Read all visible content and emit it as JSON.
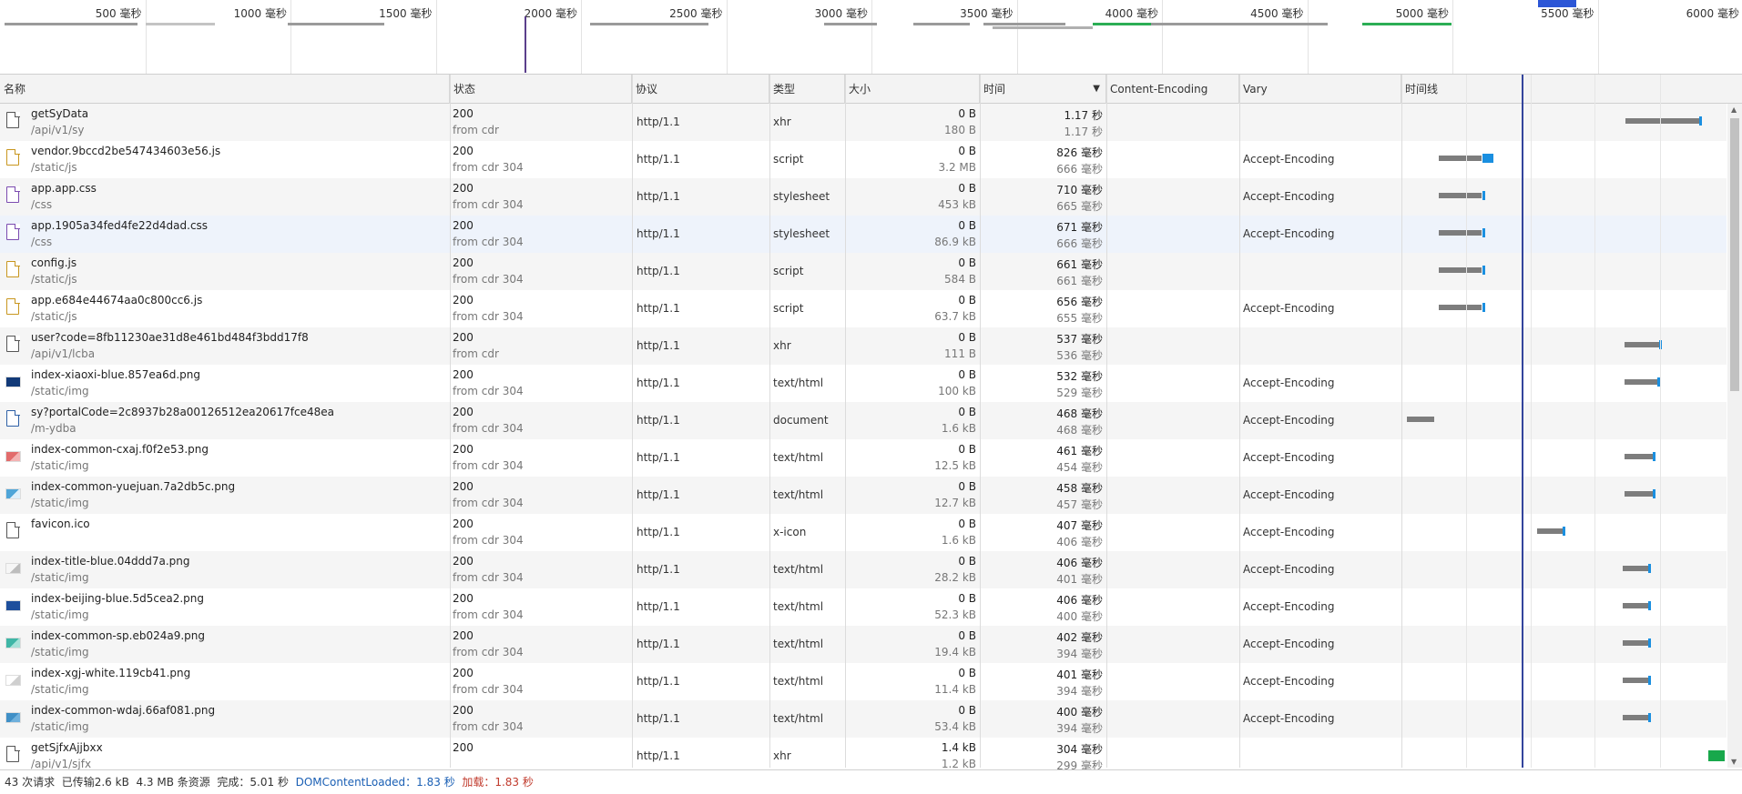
{
  "overview": {
    "ticks": [
      "500 毫秒",
      "1000 毫秒",
      "1500 毫秒",
      "2000 毫秒",
      "2500 毫秒",
      "3000 毫秒",
      "3500 毫秒",
      "4000 毫秒",
      "4500 毫秒",
      "5000 毫秒",
      "5500 毫秒",
      "6000 毫秒"
    ]
  },
  "columns": {
    "name": "名称",
    "status": "状态",
    "protocol": "协议",
    "type": "类型",
    "size": "大小",
    "time": "时间",
    "encoding": "Content-Encoding",
    "vary": "Vary",
    "timeline": "时间线"
  },
  "rows": [
    {
      "name": "getSyData",
      "path": "/api/v1/sy",
      "icon": "file",
      "status": "200",
      "source": "from cdr",
      "protocol": "http/1.1",
      "type": "xhr",
      "size1": "0 B",
      "size2": "180 B",
      "time1": "1.17 秒",
      "time2": "1.17 秒",
      "vary": ""
    },
    {
      "name": "vendor.9bccd2be547434603e56.js",
      "path": "/static/js",
      "icon": "js",
      "status": "200",
      "source": "from cdr 304",
      "protocol": "http/1.1",
      "type": "script",
      "size1": "0 B",
      "size2": "3.2 MB",
      "time1": "826 毫秒",
      "time2": "666 毫秒",
      "vary": "Accept-Encoding"
    },
    {
      "name": "app.app.css",
      "path": "/css",
      "icon": "css",
      "status": "200",
      "source": "from cdr 304",
      "protocol": "http/1.1",
      "type": "stylesheet",
      "size1": "0 B",
      "size2": "453 kB",
      "time1": "710 毫秒",
      "time2": "665 毫秒",
      "vary": "Accept-Encoding"
    },
    {
      "name": "app.1905a34fed4fe22d4dad.css",
      "path": "/css",
      "icon": "css",
      "status": "200",
      "source": "from cdr 304",
      "protocol": "http/1.1",
      "type": "stylesheet",
      "size1": "0 B",
      "size2": "86.9 kB",
      "time1": "671 毫秒",
      "time2": "666 毫秒",
      "vary": "Accept-Encoding"
    },
    {
      "name": "config.js",
      "path": "/static/js",
      "icon": "js",
      "status": "200",
      "source": "from cdr 304",
      "protocol": "http/1.1",
      "type": "script",
      "size1": "0 B",
      "size2": "584 B",
      "time1": "661 毫秒",
      "time2": "661 毫秒",
      "vary": ""
    },
    {
      "name": "app.e684e44674aa0c800cc6.js",
      "path": "/static/js",
      "icon": "js",
      "status": "200",
      "source": "from cdr 304",
      "protocol": "http/1.1",
      "type": "script",
      "size1": "0 B",
      "size2": "63.7 kB",
      "time1": "656 毫秒",
      "time2": "655 毫秒",
      "vary": "Accept-Encoding"
    },
    {
      "name": "user?code=8fb11230ae31d8e461bd484f3bdd17f8",
      "path": "/api/v1/lcba",
      "icon": "file",
      "status": "200",
      "source": "from cdr",
      "protocol": "http/1.1",
      "type": "xhr",
      "size1": "0 B",
      "size2": "111 B",
      "time1": "537 毫秒",
      "time2": "536 毫秒",
      "vary": ""
    },
    {
      "name": "index-xiaoxi-blue.857ea6d.png",
      "path": "/static/img",
      "icon": "img-navy",
      "status": "200",
      "source": "from cdr 304",
      "protocol": "http/1.1",
      "type": "text/html",
      "size1": "0 B",
      "size2": "100 kB",
      "time1": "532 毫秒",
      "time2": "529 毫秒",
      "vary": "Accept-Encoding"
    },
    {
      "name": "sy?portalCode=2c8937b28a00126512ea20617fce48ea",
      "path": "/m-ydba",
      "icon": "doc",
      "status": "200",
      "source": "from cdr 304",
      "protocol": "http/1.1",
      "type": "document",
      "size1": "0 B",
      "size2": "1.6 kB",
      "time1": "468 毫秒",
      "time2": "468 毫秒",
      "vary": "Accept-Encoding"
    },
    {
      "name": "index-common-cxaj.f0f2e53.png",
      "path": "/static/img",
      "icon": "img-red",
      "status": "200",
      "source": "from cdr 304",
      "protocol": "http/1.1",
      "type": "text/html",
      "size1": "0 B",
      "size2": "12.5 kB",
      "time1": "461 毫秒",
      "time2": "454 毫秒",
      "vary": "Accept-Encoding"
    },
    {
      "name": "index-common-yuejuan.7a2db5c.png",
      "path": "/static/img",
      "icon": "img-cyan",
      "status": "200",
      "source": "from cdr 304",
      "protocol": "http/1.1",
      "type": "text/html",
      "size1": "0 B",
      "size2": "12.7 kB",
      "time1": "458 毫秒",
      "time2": "457 毫秒",
      "vary": "Accept-Encoding"
    },
    {
      "name": "favicon.ico",
      "path": "",
      "icon": "file",
      "status": "200",
      "source": "from cdr 304",
      "protocol": "http/1.1",
      "type": "x-icon",
      "size1": "0 B",
      "size2": "1.6 kB",
      "time1": "407 毫秒",
      "time2": "406 毫秒",
      "vary": "Accept-Encoding"
    },
    {
      "name": "index-title-blue.04ddd7a.png",
      "path": "/static/img",
      "icon": "img-line",
      "status": "200",
      "source": "from cdr 304",
      "protocol": "http/1.1",
      "type": "text/html",
      "size1": "0 B",
      "size2": "28.2 kB",
      "time1": "406 毫秒",
      "time2": "401 毫秒",
      "vary": "Accept-Encoding"
    },
    {
      "name": "index-beijing-blue.5d5cea2.png",
      "path": "/static/img",
      "icon": "img-blue",
      "status": "200",
      "source": "from cdr 304",
      "protocol": "http/1.1",
      "type": "text/html",
      "size1": "0 B",
      "size2": "52.3 kB",
      "time1": "406 毫秒",
      "time2": "400 毫秒",
      "vary": "Accept-Encoding"
    },
    {
      "name": "index-common-sp.eb024a9.png",
      "path": "/static/img",
      "icon": "img-teal",
      "status": "200",
      "source": "from cdr 304",
      "protocol": "http/1.1",
      "type": "text/html",
      "size1": "0 B",
      "size2": "19.4 kB",
      "time1": "402 毫秒",
      "time2": "394 毫秒",
      "vary": "Accept-Encoding"
    },
    {
      "name": "index-xgj-white.119cb41.png",
      "path": "/static/img",
      "icon": "img-white",
      "status": "200",
      "source": "from cdr 304",
      "protocol": "http/1.1",
      "type": "text/html",
      "size1": "0 B",
      "size2": "11.4 kB",
      "time1": "401 毫秒",
      "time2": "394 毫秒",
      "vary": "Accept-Encoding"
    },
    {
      "name": "index-common-wdaj.66af081.png",
      "path": "/static/img",
      "icon": "img-sky",
      "status": "200",
      "source": "from cdr 304",
      "protocol": "http/1.1",
      "type": "text/html",
      "size1": "0 B",
      "size2": "53.4 kB",
      "time1": "400 毫秒",
      "time2": "394 毫秒",
      "vary": "Accept-Encoding"
    },
    {
      "name": "getSjfxAjjbxx",
      "path": "/api/v1/sjfx",
      "icon": "file",
      "status": "200",
      "source": "",
      "protocol": "http/1.1",
      "type": "xhr",
      "size1": "1.4 kB",
      "size2": "1.2 kB",
      "time1": "304 毫秒",
      "time2": "299 毫秒",
      "vary": ""
    }
  ],
  "status_bar": {
    "requests": "43 次请求",
    "transferred": "已传输2.6 kB",
    "resources": "4.3 MB 条资源",
    "finish": "完成：5.01 秒",
    "dcl": "DOMContentLoaded：1.83 秒",
    "load": "加载：1.83 秒"
  },
  "colors": {
    "dcl": "#1a5fb4",
    "load": "#c0392b",
    "waiting": "#7d7d7d",
    "receiving": "#1a8fe0"
  }
}
